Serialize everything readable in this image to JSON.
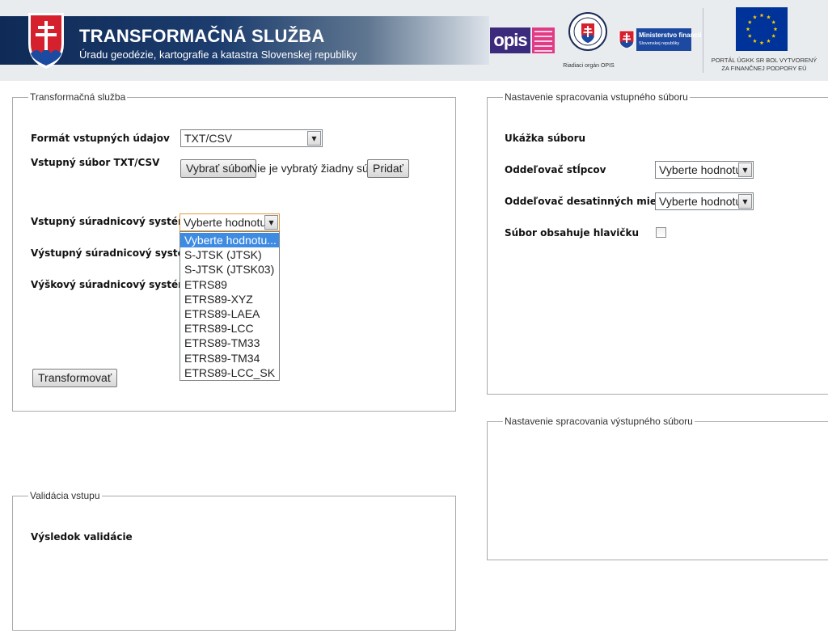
{
  "header": {
    "title": "TRANSFORMAČNÁ SLUŽBA",
    "subtitle": "Úradu geodézie, kartografie a katastra Slovenskej republiky",
    "opis_logo": "opis",
    "seal_caption": "Riadiaci orgán OPIS",
    "mf_title": "Ministerstvo financií",
    "mf_subtitle": "Slovenskej republiky",
    "eu_caption_line1": "PORTÁL ÚGKK SR BOL VYTVORENÝ",
    "eu_caption_line2": "ZA FINANČNEJ PODPORY EÚ",
    "icons": [
      "sk-coat-of-arms-icon",
      "opis-logo-icon",
      "state-seal-icon",
      "mf-flag-icon",
      "eu-flag-icon"
    ],
    "colors": {
      "band_dark": "#0f2a56",
      "opis_purple": "#3c2a7c",
      "opis_pink": "#e03b86",
      "mf_blue": "#1d4aa0",
      "eu_blue": "#003399",
      "eu_star": "#ffcc00"
    }
  },
  "transform": {
    "legend": "Transformačná služba",
    "format_label": "Formát vstupných údajov",
    "format_value": "TXT/CSV",
    "file_label": "Vstupný súbor TXT/CSV",
    "choose_button": "Vybrať súbor",
    "no_file_text": "Nie je vybratý žiadny súbor",
    "add_button": "Pridať",
    "input_crs_label": "Vstupný súradnicový systém",
    "input_crs_value": "Vyberte hodnotu...",
    "output_crs_label": "Výstupný súradnicový systém",
    "height_crs_label": "Výškový súradnicový systém",
    "transform_button": "Transformovať",
    "dropdown_options": [
      "Vyberte hodnotu...",
      "S-JTSK (JTSK)",
      "S-JTSK (JTSK03)",
      "ETRS89",
      "ETRS89-XYZ",
      "ETRS89-LAEA",
      "ETRS89-LCC",
      "ETRS89-TM33",
      "ETRS89-TM34",
      "ETRS89-LCC_SK"
    ],
    "dropdown_selected": "Vyberte hodnotu..."
  },
  "input_settings": {
    "legend": "Nastavenie spracovania vstupného súboru",
    "sample_label": "Ukážka súboru",
    "column_sep_label": "Oddeľovač stĺpcov",
    "column_sep_value": "Vyberte hodnotu...",
    "decimal_sep_label": "Oddeľovač desatinných miest",
    "decimal_sep_value": "Vyberte hodnotu...",
    "header_label": "Súbor obsahuje hlavičku",
    "header_checked": false
  },
  "output_settings": {
    "legend": "Nastavenie spracovania výstupného súboru"
  },
  "validation": {
    "legend": "Validácia vstupu",
    "result_label": "Výsledok validácie"
  },
  "ui": {
    "arrow_glyph": "▼"
  }
}
